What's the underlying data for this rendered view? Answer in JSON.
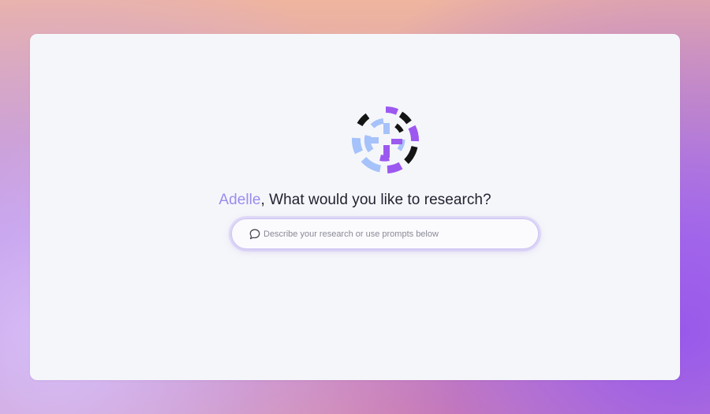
{
  "page": {
    "user_name": "Adelle",
    "prompt_title": "What would you like to research?",
    "name_separator": ","
  },
  "search": {
    "placeholder": "Describe your research or use prompts below",
    "value": "",
    "icon": "chat-bubble-icon"
  },
  "logo": {
    "icon": "radial-burst-logo",
    "colors": [
      "#9c59f0",
      "#a6c2fa",
      "#141414"
    ]
  },
  "colors": {
    "accent": "#9b8cee",
    "card_background": "#f5f6fa",
    "input_border": "#cfc4f3",
    "title_text": "#222230"
  }
}
